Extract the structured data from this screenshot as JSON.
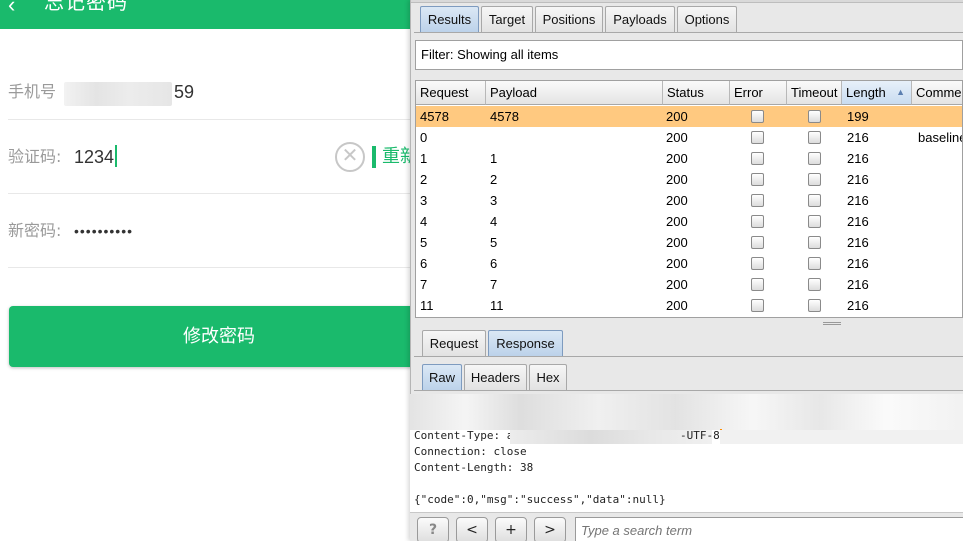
{
  "mobile": {
    "header": {
      "back_icon": "chevron-left-icon",
      "title": "忘记密码"
    },
    "phone": {
      "label": "手机号",
      "suffix": "59"
    },
    "code": {
      "label": "验证码:",
      "value": "1234",
      "clear_icon": "close-circle-icon",
      "resend_label": "重新"
    },
    "new_password": {
      "label": "新密码:",
      "value": "••••••••••"
    },
    "submit_label": "修改密码",
    "accent": "#1aba6c"
  },
  "burp": {
    "main_tabs": [
      "Results",
      "Target",
      "Positions",
      "Payloads",
      "Options"
    ],
    "active_main_tab": "Results",
    "filter_text": "Filter: Showing all items",
    "table": {
      "columns": [
        "Request",
        "Payload",
        "Status",
        "Error",
        "Timeout",
        "Length",
        "Comment"
      ],
      "sorted_column": "Length",
      "rows": [
        {
          "request": "4578",
          "payload": "4578",
          "status": "200",
          "error": false,
          "timeout": false,
          "length": "199",
          "comment": "",
          "highlight": true
        },
        {
          "request": "0",
          "payload": "",
          "status": "200",
          "error": false,
          "timeout": false,
          "length": "216",
          "comment": "baseline",
          "highlight": false
        },
        {
          "request": "1",
          "payload": "1",
          "status": "200",
          "error": false,
          "timeout": false,
          "length": "216",
          "comment": "",
          "highlight": false
        },
        {
          "request": "2",
          "payload": "2",
          "status": "200",
          "error": false,
          "timeout": false,
          "length": "216",
          "comment": "",
          "highlight": false
        },
        {
          "request": "3",
          "payload": "3",
          "status": "200",
          "error": false,
          "timeout": false,
          "length": "216",
          "comment": "",
          "highlight": false
        },
        {
          "request": "4",
          "payload": "4",
          "status": "200",
          "error": false,
          "timeout": false,
          "length": "216",
          "comment": "",
          "highlight": false
        },
        {
          "request": "5",
          "payload": "5",
          "status": "200",
          "error": false,
          "timeout": false,
          "length": "216",
          "comment": "",
          "highlight": false
        },
        {
          "request": "6",
          "payload": "6",
          "status": "200",
          "error": false,
          "timeout": false,
          "length": "216",
          "comment": "",
          "highlight": false
        },
        {
          "request": "7",
          "payload": "7",
          "status": "200",
          "error": false,
          "timeout": false,
          "length": "216",
          "comment": "",
          "highlight": false
        },
        {
          "request": "11",
          "payload": "11",
          "status": "200",
          "error": false,
          "timeout": false,
          "length": "216",
          "comment": "",
          "highlight": false
        }
      ]
    },
    "message_tabs": [
      "Request",
      "Response"
    ],
    "active_message_tab": "Response",
    "view_tabs": [
      "Raw",
      "Headers",
      "Hex"
    ],
    "active_view_tab": "Raw",
    "raw": {
      "content_type_visible_start": "Content-Type: appli",
      "content_type_visible_end": "-UTF-8",
      "connection": "Connection: close",
      "content_length": "Content-Length: 38",
      "body": "{\"code\":0,\"msg\":\"success\",\"data\":null}"
    },
    "bottom": {
      "help_label": "?",
      "prev_label": "<",
      "add_label": "+",
      "next_label": ">",
      "search_placeholder": "Type a search term"
    },
    "highlight_color": "#ffc980"
  }
}
